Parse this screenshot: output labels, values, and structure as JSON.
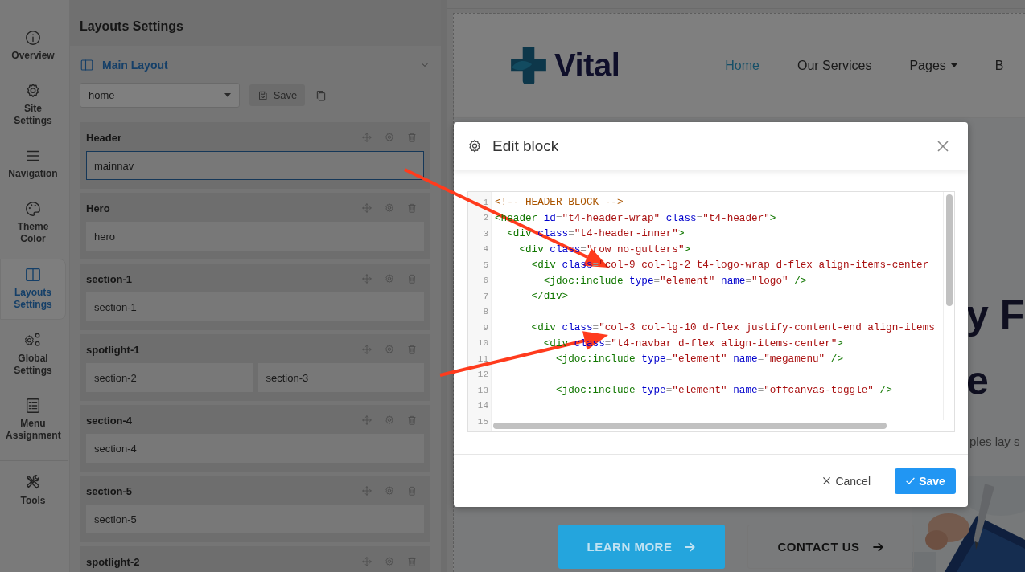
{
  "sidebar": {
    "items": [
      {
        "label": "Overview",
        "selected": false
      },
      {
        "label": "Site Settings",
        "selected": false
      },
      {
        "label": "Navigation",
        "selected": false
      },
      {
        "label": "Theme Color",
        "selected": false
      },
      {
        "label": "Layouts Settings",
        "selected": true
      },
      {
        "label": "Global Settings",
        "selected": false
      },
      {
        "label": "Menu Assignment",
        "selected": false
      },
      {
        "label": "Tools",
        "selected": false
      }
    ]
  },
  "panel": {
    "title": "Layouts Settings",
    "section": {
      "title": "Main Layout",
      "expanded": true
    },
    "layout_select": {
      "value": "home"
    },
    "save_button": "Save",
    "blocks": [
      {
        "title": "Header",
        "positions": [
          {
            "name": "mainnav",
            "selected": true
          }
        ]
      },
      {
        "title": "Hero",
        "positions": [
          {
            "name": "hero",
            "selected": false
          }
        ]
      },
      {
        "title": "section-1",
        "positions": [
          {
            "name": "section-1",
            "selected": false
          }
        ]
      },
      {
        "title": "spotlight-1",
        "positions": [
          {
            "name": "section-2",
            "selected": false
          },
          {
            "name": "section-3",
            "selected": false
          }
        ]
      },
      {
        "title": "section-4",
        "positions": [
          {
            "name": "section-4",
            "selected": false
          }
        ]
      },
      {
        "title": "section-5",
        "positions": [
          {
            "name": "section-5",
            "selected": false
          }
        ]
      },
      {
        "title": "spotlight-2"
      }
    ]
  },
  "preview": {
    "logo": "Vital",
    "nav": [
      {
        "label": "Home",
        "selected": true,
        "has_menu": false
      },
      {
        "label": "Our Services",
        "selected": false,
        "has_menu": false
      },
      {
        "label": "Pages",
        "selected": false,
        "has_menu": true
      },
      {
        "label": "B",
        "selected": false,
        "has_menu": false
      }
    ],
    "hero_lines": [
      "y F",
      "e"
    ],
    "hero_text": "ples lay s",
    "buttons": [
      {
        "label": "LEARN MORE",
        "kind": "primary"
      },
      {
        "label": "CONTACT US",
        "kind": "outline"
      }
    ]
  },
  "dialog": {
    "title": "Edit block",
    "code_lines": [
      {
        "number": "1",
        "tokens": [
          {
            "kind": "comment",
            "text": "<!-- HEADER BLOCK -->"
          }
        ]
      },
      {
        "number": "2",
        "tokens": [
          {
            "kind": "tag",
            "text": "<header "
          },
          {
            "kind": "attr",
            "text": "id"
          },
          {
            "kind": "punct",
            "text": "="
          },
          {
            "kind": "string",
            "text": "\"t4-header-wrap\""
          },
          {
            "kind": "attr",
            "text": " class"
          },
          {
            "kind": "punct",
            "text": "="
          },
          {
            "kind": "string",
            "text": "\"t4-header\""
          },
          {
            "kind": "tag",
            "text": ">"
          }
        ]
      },
      {
        "number": "3",
        "tokens": [
          {
            "kind": "tag",
            "text": "  <div "
          },
          {
            "kind": "attr",
            "text": "class"
          },
          {
            "kind": "punct",
            "text": "="
          },
          {
            "kind": "string",
            "text": "\"t4-header-inner\""
          },
          {
            "kind": "tag",
            "text": ">"
          }
        ]
      },
      {
        "number": "4",
        "tokens": [
          {
            "kind": "tag",
            "text": "    <div "
          },
          {
            "kind": "attr",
            "text": "class"
          },
          {
            "kind": "punct",
            "text": "="
          },
          {
            "kind": "string",
            "text": "\"row no-gutters\""
          },
          {
            "kind": "tag",
            "text": ">"
          }
        ]
      },
      {
        "number": "5",
        "tokens": [
          {
            "kind": "tag",
            "text": "      <div "
          },
          {
            "kind": "attr",
            "text": "class"
          },
          {
            "kind": "punct",
            "text": "="
          },
          {
            "kind": "string",
            "text": "\"col-9 col-lg-2 t4-logo-wrap d-flex align-items-center"
          }
        ]
      },
      {
        "number": "6",
        "tokens": [
          {
            "kind": "tag",
            "text": "        <jdoc:include "
          },
          {
            "kind": "attr",
            "text": "type"
          },
          {
            "kind": "punct",
            "text": "="
          },
          {
            "kind": "string",
            "text": "\"element\""
          },
          {
            "kind": "attr",
            "text": " name"
          },
          {
            "kind": "punct",
            "text": "="
          },
          {
            "kind": "string",
            "text": "\"logo\""
          },
          {
            "kind": "tag",
            "text": " />"
          }
        ]
      },
      {
        "number": "7",
        "tokens": [
          {
            "kind": "tag",
            "text": "      </div>"
          }
        ]
      },
      {
        "number": "8"
      },
      {
        "number": "9",
        "tokens": [
          {
            "kind": "tag",
            "text": "      <div "
          },
          {
            "kind": "attr",
            "text": "class"
          },
          {
            "kind": "punct",
            "text": "="
          },
          {
            "kind": "string",
            "text": "\"col-3 col-lg-10 d-flex justify-content-end align-items"
          }
        ]
      },
      {
        "number": "10",
        "tokens": [
          {
            "kind": "tag",
            "text": "        <div "
          },
          {
            "kind": "attr",
            "text": "class"
          },
          {
            "kind": "punct",
            "text": "="
          },
          {
            "kind": "string",
            "text": "\"t4-navbar d-flex align-items-center\""
          },
          {
            "kind": "tag",
            "text": ">"
          }
        ]
      },
      {
        "number": "11",
        "tokens": [
          {
            "kind": "tag",
            "text": "          <jdoc:include "
          },
          {
            "kind": "attr",
            "text": "type"
          },
          {
            "kind": "punct",
            "text": "="
          },
          {
            "kind": "string",
            "text": "\"element\""
          },
          {
            "kind": "attr",
            "text": " name"
          },
          {
            "kind": "punct",
            "text": "="
          },
          {
            "kind": "string",
            "text": "\"megamenu\""
          },
          {
            "kind": "tag",
            "text": " />"
          }
        ]
      },
      {
        "number": "12"
      },
      {
        "number": "13",
        "tokens": [
          {
            "kind": "tag",
            "text": "          <jdoc:include "
          },
          {
            "kind": "attr",
            "text": "type"
          },
          {
            "kind": "punct",
            "text": "="
          },
          {
            "kind": "string",
            "text": "\"element\""
          },
          {
            "kind": "attr",
            "text": " name"
          },
          {
            "kind": "punct",
            "text": "="
          },
          {
            "kind": "string",
            "text": "\"offcanvas-toggle\""
          },
          {
            "kind": "tag",
            "text": " />"
          }
        ]
      },
      {
        "number": "14"
      },
      {
        "number": "15"
      }
    ],
    "buttons": [
      {
        "label": "Cancel",
        "kind": "cancel"
      },
      {
        "label": "Save",
        "kind": "primary"
      }
    ]
  },
  "annotations": [
    {
      "kind": "arrow"
    },
    {
      "kind": "arrow"
    }
  ]
}
